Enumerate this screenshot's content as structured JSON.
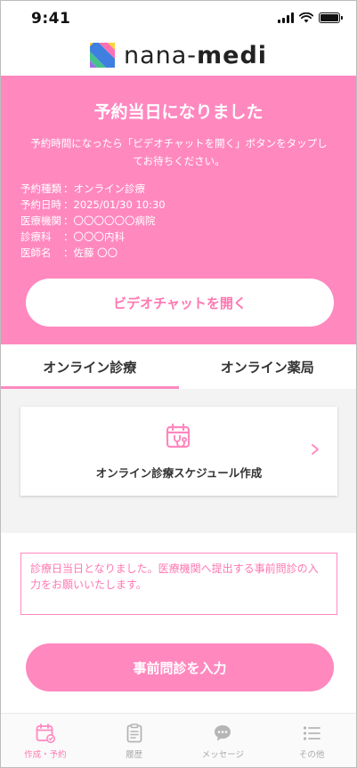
{
  "status_bar": {
    "time": "9:41"
  },
  "header": {
    "logo_text_a": "nana-",
    "logo_text_b": "medi"
  },
  "banner": {
    "title": "予約当日になりました",
    "message": "予約時間になったら「ビデオチャットを開く」ボタンをタップしてお待ちください。",
    "info": [
      {
        "key": "予約種類",
        "value": "：オンライン診療"
      },
      {
        "key": "予約日時",
        "value": "：2025/01/30 10:30"
      },
      {
        "key": "医療機関",
        "value": "：〇〇〇〇〇〇病院"
      },
      {
        "key": "診療科",
        "value": "：〇〇〇内科"
      },
      {
        "key": "医師名",
        "value": "：佐藤 〇〇"
      }
    ],
    "open_video_label": "ビデオチャットを開く"
  },
  "tabs": [
    {
      "label": "オンライン診療",
      "active": true
    },
    {
      "label": "オンライン薬局",
      "active": false
    }
  ],
  "schedule_card": {
    "label": "オンライン診療スケジュール作成",
    "icon": "calendar-stethoscope-icon"
  },
  "notice": {
    "text": "診療日当日となりました。医療機関へ提出する事前問診の入力をお願いいたします。"
  },
  "pre_exam_button": {
    "label": "事前問診を入力"
  },
  "bottom_nav": [
    {
      "label": "作成・予約",
      "icon": "calendar-check-icon",
      "active": true
    },
    {
      "label": "履歴",
      "icon": "clipboard-icon",
      "active": false
    },
    {
      "label": "メッセージ",
      "icon": "chat-bubble-icon",
      "active": false
    },
    {
      "label": "その他",
      "icon": "list-icon",
      "active": false
    }
  ],
  "colors": {
    "accent": "#ff88bf",
    "accent_text": "#ff77b2",
    "nav_inactive": "#aaaaaa"
  }
}
